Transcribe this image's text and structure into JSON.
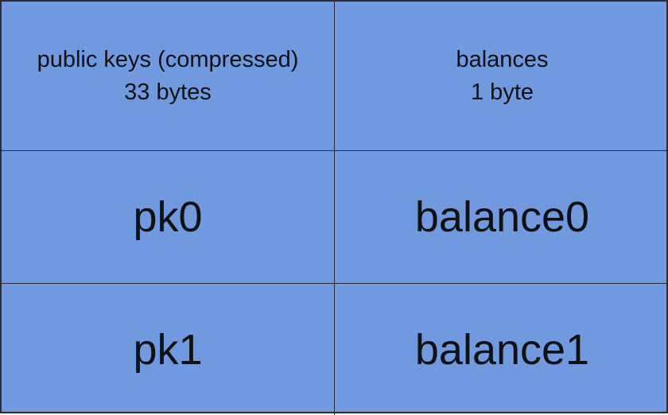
{
  "table": {
    "headers": [
      {
        "line1": "public keys (compressed)",
        "line2": "33 bytes"
      },
      {
        "line1": "balances",
        "line2": "1 byte"
      }
    ],
    "rows": [
      {
        "key": "pk0",
        "balance": "balance0"
      },
      {
        "key": "pk1",
        "balance": "balance1"
      }
    ]
  },
  "colors": {
    "cell_fill": "#7099e0",
    "border": "#2c2c2c",
    "text": "#111111"
  }
}
